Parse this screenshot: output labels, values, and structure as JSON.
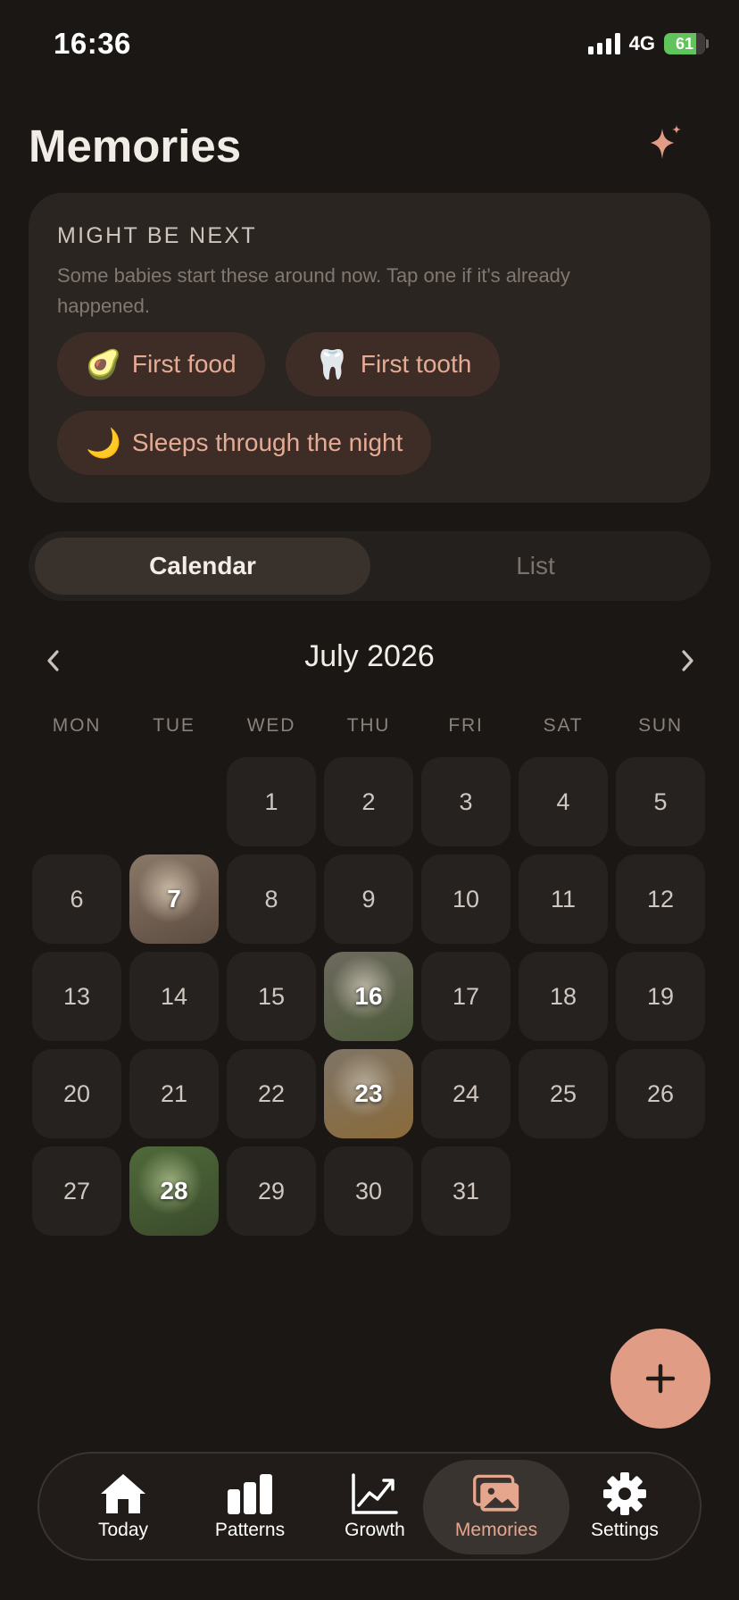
{
  "status_bar": {
    "time": "16:36",
    "network": "4G",
    "battery": "61"
  },
  "header": {
    "title": "Memories",
    "icon": "sparkle-icon",
    "accent_color": "#e09c84"
  },
  "next_card": {
    "heading": "MIGHT BE NEXT",
    "description": "Some babies start these around now. Tap one if it's already happened.",
    "chips": [
      {
        "emoji": "🥑",
        "label": "First food"
      },
      {
        "emoji": "🦷",
        "label": "First tooth"
      },
      {
        "emoji": "🌙",
        "label": "Sleeps through the night"
      }
    ]
  },
  "view_toggle": {
    "active": "Calendar",
    "inactive": "List"
  },
  "calendar": {
    "month": "July 2026",
    "weekdays": [
      "MON",
      "TUE",
      "WED",
      "THU",
      "FRI",
      "SAT",
      "SUN"
    ],
    "days_with_photos": [
      "7",
      "16",
      "23",
      "28"
    ],
    "rows": [
      [
        "",
        "",
        "1",
        "2",
        "3",
        "4",
        "5"
      ],
      [
        "6",
        "7",
        "8",
        "9",
        "10",
        "11",
        "12"
      ],
      [
        "13",
        "14",
        "15",
        "16",
        "17",
        "18",
        "19"
      ],
      [
        "20",
        "21",
        "22",
        "23",
        "24",
        "25",
        "26"
      ],
      [
        "27",
        "28",
        "29",
        "30",
        "31",
        "",
        ""
      ]
    ]
  },
  "fab": {
    "icon": "plus-icon"
  },
  "tabbar": {
    "active": "Memories",
    "tabs": [
      {
        "label": "Today",
        "icon": "home-icon"
      },
      {
        "label": "Patterns",
        "icon": "bar-chart-icon"
      },
      {
        "label": "Growth",
        "icon": "trend-up-icon"
      },
      {
        "label": "Memories",
        "icon": "photos-icon"
      },
      {
        "label": "Settings",
        "icon": "gear-icon"
      }
    ]
  }
}
